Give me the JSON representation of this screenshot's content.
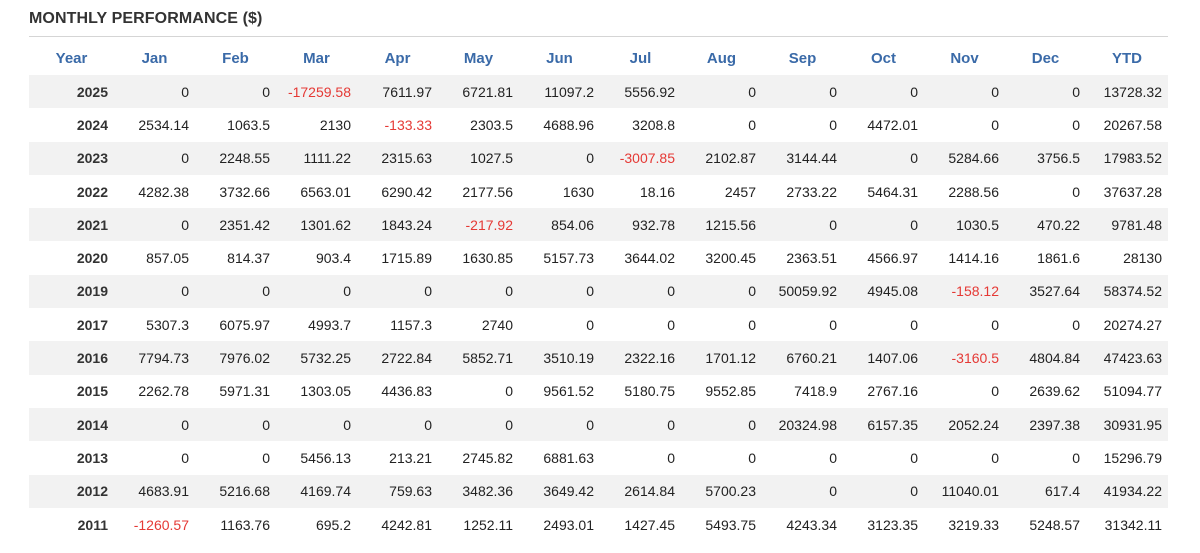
{
  "title": "MONTHLY PERFORMANCE ($)",
  "colors": {
    "header_text": "#3a6aa8",
    "negative": "#e53935",
    "row_shade": "#f2f2f2"
  },
  "headers": [
    "Year",
    "Jan",
    "Feb",
    "Mar",
    "Apr",
    "May",
    "Jun",
    "Jul",
    "Aug",
    "Sep",
    "Oct",
    "Nov",
    "Dec",
    "YTD"
  ],
  "rows": [
    [
      "2025",
      "0",
      "0",
      "-17259.58",
      "7611.97",
      "6721.81",
      "11097.2",
      "5556.92",
      "0",
      "0",
      "0",
      "0",
      "0",
      "13728.32"
    ],
    [
      "2024",
      "2534.14",
      "1063.5",
      "2130",
      "-133.33",
      "2303.5",
      "4688.96",
      "3208.8",
      "0",
      "0",
      "4472.01",
      "0",
      "0",
      "20267.58"
    ],
    [
      "2023",
      "0",
      "2248.55",
      "1111.22",
      "2315.63",
      "1027.5",
      "0",
      "-3007.85",
      "2102.87",
      "3144.44",
      "0",
      "5284.66",
      "3756.5",
      "17983.52"
    ],
    [
      "2022",
      "4282.38",
      "3732.66",
      "6563.01",
      "6290.42",
      "2177.56",
      "1630",
      "18.16",
      "2457",
      "2733.22",
      "5464.31",
      "2288.56",
      "0",
      "37637.28"
    ],
    [
      "2021",
      "0",
      "2351.42",
      "1301.62",
      "1843.24",
      "-217.92",
      "854.06",
      "932.78",
      "1215.56",
      "0",
      "0",
      "1030.5",
      "470.22",
      "9781.48"
    ],
    [
      "2020",
      "857.05",
      "814.37",
      "903.4",
      "1715.89",
      "1630.85",
      "5157.73",
      "3644.02",
      "3200.45",
      "2363.51",
      "4566.97",
      "1414.16",
      "1861.6",
      "28130"
    ],
    [
      "2019",
      "0",
      "0",
      "0",
      "0",
      "0",
      "0",
      "0",
      "0",
      "50059.92",
      "4945.08",
      "-158.12",
      "3527.64",
      "58374.52"
    ],
    [
      "2017",
      "5307.3",
      "6075.97",
      "4993.7",
      "1157.3",
      "2740",
      "0",
      "0",
      "0",
      "0",
      "0",
      "0",
      "0",
      "20274.27"
    ],
    [
      "2016",
      "7794.73",
      "7976.02",
      "5732.25",
      "2722.84",
      "5852.71",
      "3510.19",
      "2322.16",
      "1701.12",
      "6760.21",
      "1407.06",
      "-3160.5",
      "4804.84",
      "47423.63"
    ],
    [
      "2015",
      "2262.78",
      "5971.31",
      "1303.05",
      "4436.83",
      "0",
      "9561.52",
      "5180.75",
      "9552.85",
      "7418.9",
      "2767.16",
      "0",
      "2639.62",
      "51094.77"
    ],
    [
      "2014",
      "0",
      "0",
      "0",
      "0",
      "0",
      "0",
      "0",
      "0",
      "20324.98",
      "6157.35",
      "2052.24",
      "2397.38",
      "30931.95"
    ],
    [
      "2013",
      "0",
      "0",
      "5456.13",
      "213.21",
      "2745.82",
      "6881.63",
      "0",
      "0",
      "0",
      "0",
      "0",
      "0",
      "15296.79"
    ],
    [
      "2012",
      "4683.91",
      "5216.68",
      "4169.74",
      "759.63",
      "3482.36",
      "3649.42",
      "2614.84",
      "5700.23",
      "0",
      "0",
      "11040.01",
      "617.4",
      "41934.22"
    ],
    [
      "2011",
      "-1260.57",
      "1163.76",
      "695.2",
      "4242.81",
      "1252.11",
      "2493.01",
      "1427.45",
      "5493.75",
      "4243.34",
      "3123.35",
      "3219.33",
      "5248.57",
      "31342.11"
    ]
  ]
}
